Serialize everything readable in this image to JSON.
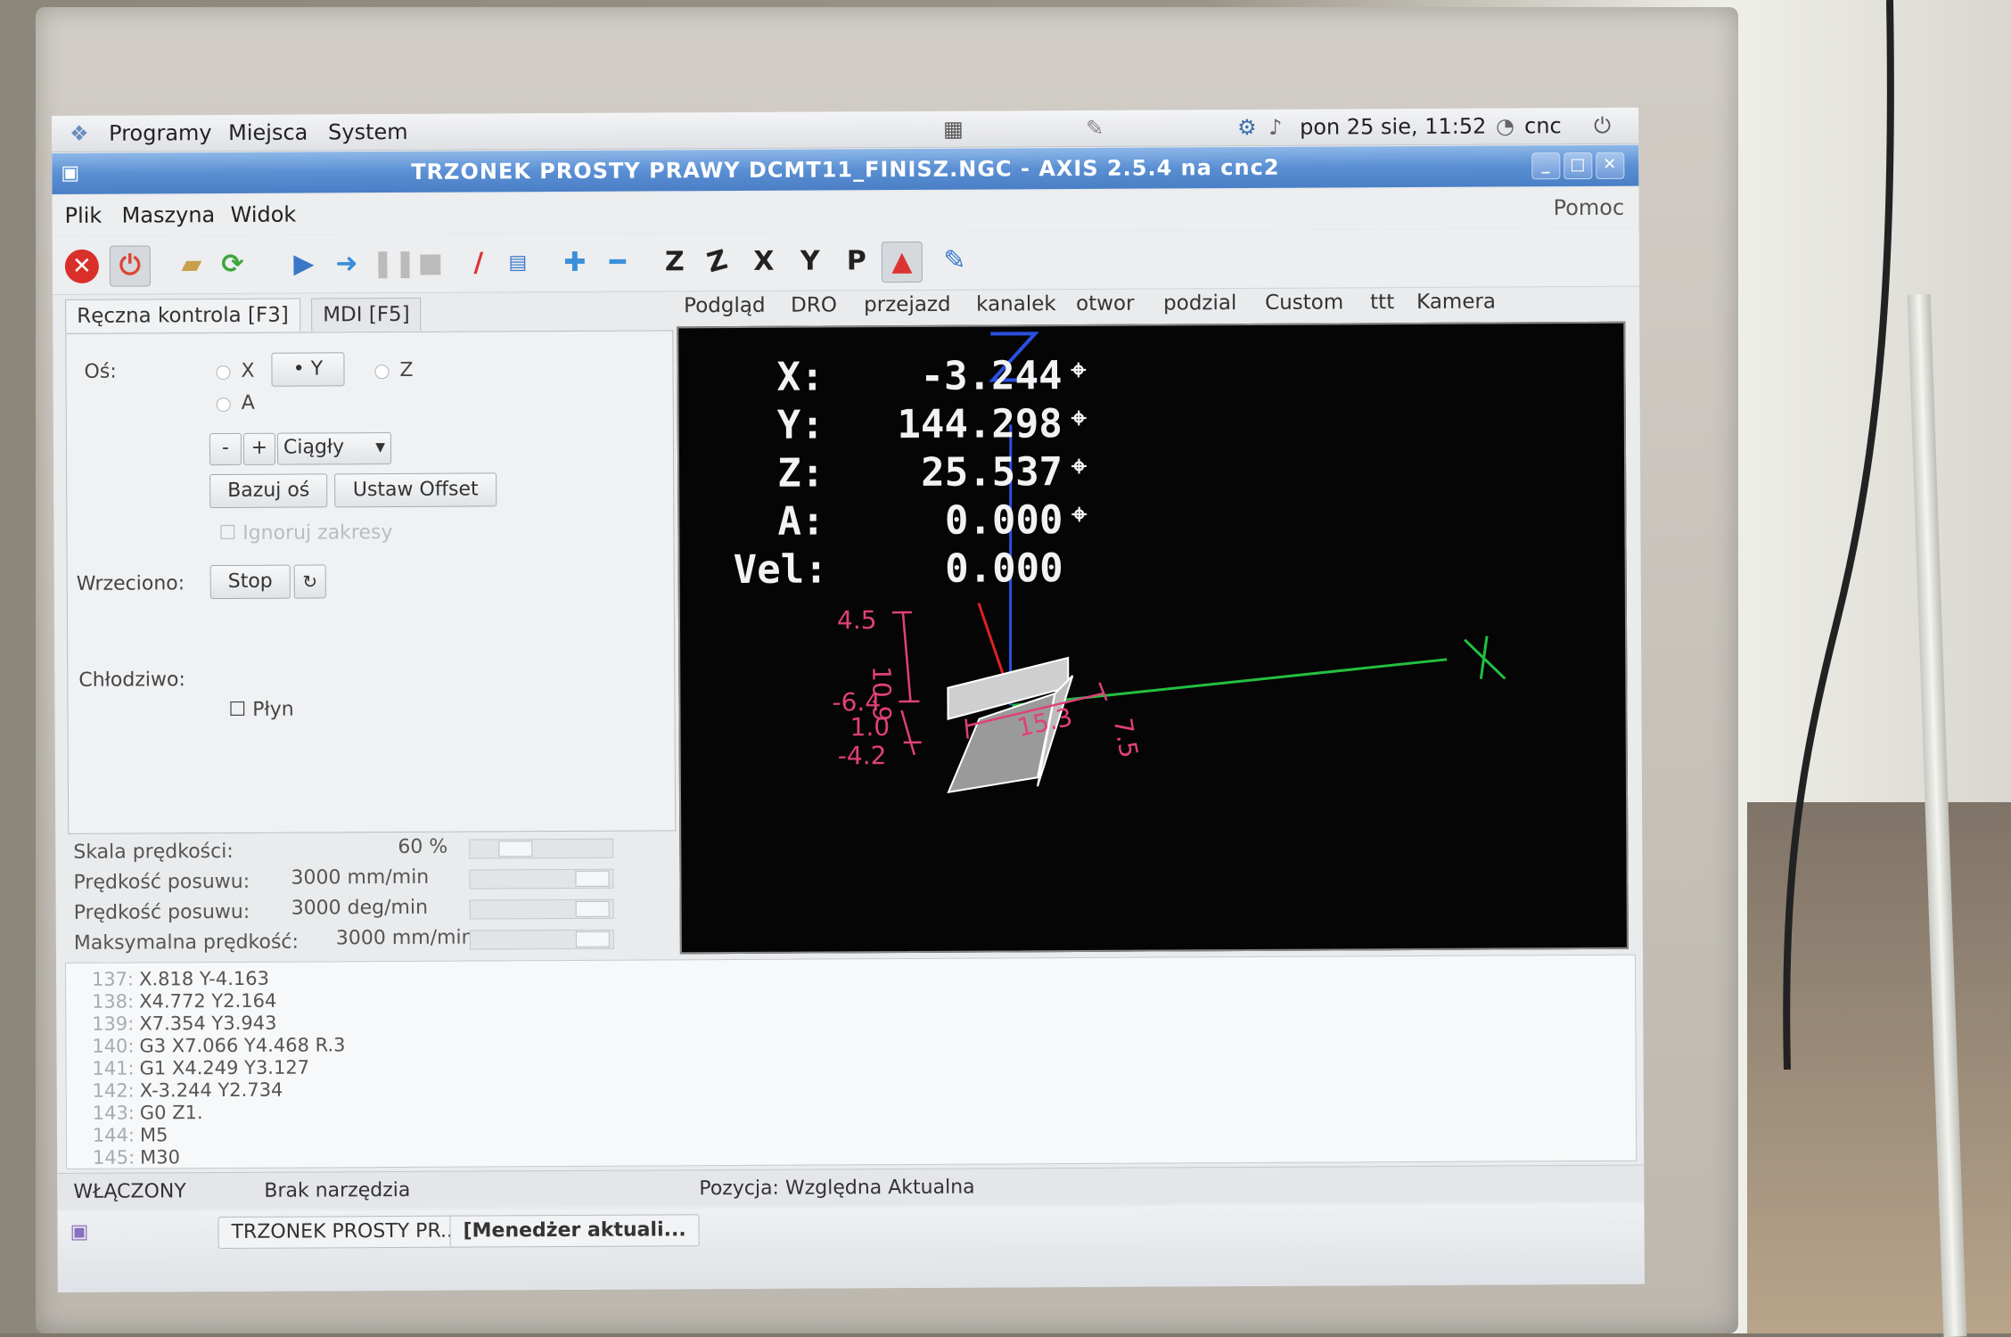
{
  "panel": {
    "menu_programs": "Programy",
    "menu_places": "Miejsca",
    "menu_system": "System",
    "datetime": "pon 25 sie, 11:52",
    "user": "cnc"
  },
  "window": {
    "title": "TRZONEK PROSTY PRAWY DCMT11_FINISZ.NGC - AXIS 2.5.4 na cnc2"
  },
  "menubar": {
    "file": "Plik",
    "machine": "Maszyna",
    "view": "Widok",
    "help": "Pomoc"
  },
  "toolbar": {
    "view_z": "Z",
    "view_z2": "Z",
    "view_x": "X",
    "view_y": "Y",
    "view_p": "P"
  },
  "left_tabs": {
    "manual": "Ręczna kontrola [F3]",
    "mdi": "MDI [F5]"
  },
  "manual": {
    "axis_label": "Oś:",
    "axis_x": "X",
    "axis_y": "Y",
    "axis_z": "Z",
    "axis_a": "A",
    "minus": "-",
    "plus": "+",
    "jog_mode": "Ciągły",
    "home_button": "Bazuj oś",
    "offset_button": "Ustaw Offset",
    "ignore_limits": "Ignoruj zakresy",
    "spindle_label": "Wrzeciono:",
    "spindle_stop": "Stop",
    "coolant_label": "Chłodziwo:",
    "coolant_flood": "Płyn"
  },
  "sliders": {
    "feed_override_label": "Skala prędkości:",
    "feed_override_value": "60 %",
    "jog_speed_label": "Prędkość posuwu:",
    "jog_speed_value": "3000 mm/min",
    "jog_angular_label": "Prędkość posuwu:",
    "jog_angular_value": "3000 deg/min",
    "max_velocity_label": "Maksymalna prędkość:",
    "max_velocity_value": "3000 mm/min"
  },
  "right_tabs": [
    "Podgląd",
    "DRO",
    "przejazd",
    "kanalek",
    "otwor",
    "podzial",
    "Custom",
    "ttt",
    "Kamera"
  ],
  "dro": {
    "x_label": "X:",
    "x_value": "-3.244",
    "y_label": "Y:",
    "y_value": "144.298",
    "z_label": "Z:",
    "z_value": "25.537",
    "a_label": "A:",
    "a_value": "0.000",
    "vel_label": "Vel:",
    "vel_value": "0.000"
  },
  "preview_dims": {
    "d1": "4.5",
    "d2": "10.9",
    "d3": "-6.4",
    "d4": "1.0",
    "d5": "-4.2",
    "d6": "15.3",
    "d7": "7.5"
  },
  "gcode": [
    {
      "n": "137:",
      "code": "X.818 Y-4.163"
    },
    {
      "n": "138:",
      "code": "X4.772 Y2.164"
    },
    {
      "n": "139:",
      "code": "X7.354 Y3.943"
    },
    {
      "n": "140:",
      "code": "G3 X7.066 Y4.468 R.3"
    },
    {
      "n": "141:",
      "code": "G1 X4.249 Y3.127"
    },
    {
      "n": "142:",
      "code": "X-3.244 Y2.734"
    },
    {
      "n": "143:",
      "code": "G0 Z1."
    },
    {
      "n": "144:",
      "code": "M5"
    },
    {
      "n": "145:",
      "code": "M30"
    }
  ],
  "status": {
    "state": "WŁĄCZONY",
    "tool": "Brak narzędzia",
    "position": "Pozycja: Względna Aktualna"
  },
  "taskbar": {
    "task1": "TRZONEK PROSTY PR...",
    "task2": "[Menedżer aktuali..."
  },
  "colors": {
    "title_blue": "#5a8fd3",
    "preview_bg": "#050505",
    "axis_x": "#e02020",
    "axis_y": "#22c040",
    "axis_z": "#2a50e0",
    "dimension": "#e0407a"
  }
}
